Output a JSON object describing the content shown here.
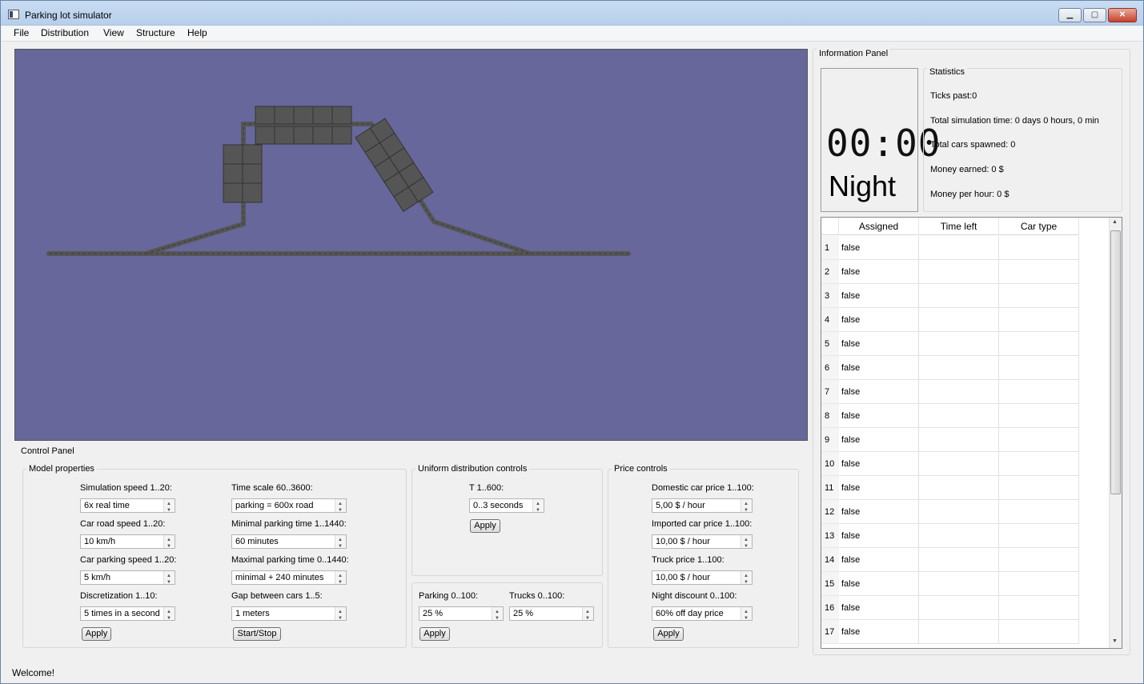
{
  "window": {
    "title": "Parking lot simulator"
  },
  "menu": [
    "File",
    "Distribution",
    "View",
    "Structure",
    "Help"
  ],
  "control_panel": {
    "title": "Control Panel",
    "model": {
      "title": "Model properties",
      "sim_speed_label": "Simulation speed 1..20:",
      "sim_speed_value": "6x real time",
      "road_speed_label": "Car road speed 1..20:",
      "road_speed_value": "10 km/h",
      "parking_speed_label": "Car parking speed 1..20:",
      "parking_speed_value": "5 km/h",
      "discretization_label": "Discretization 1..10:",
      "discretization_value": "5 times in a second",
      "time_scale_label": "Time scale 60..3600:",
      "time_scale_value": "parking = 600x road",
      "min_parking_label": "Minimal parking time 1..1440:",
      "min_parking_value": "60 minutes",
      "max_parking_label": "Maximal parking time 0..1440:",
      "max_parking_value": "minimal + 240 minutes",
      "gap_label": "Gap between cars 1..5:",
      "gap_value": "1 meters",
      "apply_label": "Apply",
      "start_stop_label": "Start/Stop"
    },
    "uniform": {
      "title": "Uniform distribution controls",
      "t_label": "T 1..600:",
      "t_value": "0..3 seconds",
      "apply_label": "Apply"
    },
    "ratios": {
      "parking_label": "Parking 0..100:",
      "parking_value": "25 %",
      "trucks_label": "Trucks 0..100:",
      "trucks_value": "25 %",
      "apply_label": "Apply"
    },
    "price": {
      "title": "Price controls",
      "domestic_label": "Domestic car price 1..100:",
      "domestic_value": "5,00 $ / hour",
      "imported_label": "Imported car price 1..100:",
      "imported_value": "10,00 $ / hour",
      "truck_label": "Truck price 1..100:",
      "truck_value": "10,00 $ / hour",
      "night_label": "Night discount 0..100:",
      "night_value": "60% off day price",
      "apply_label": "Apply"
    }
  },
  "info_panel": {
    "title": "Information Panel",
    "clock": "00:00",
    "period": "Night",
    "statistics": {
      "title": "Statistics",
      "ticks": "Ticks past:0",
      "total_time": "Total simulation time: 0 days 0 hours, 0 min",
      "cars_spawned": "Total cars spawned: 0",
      "money": "Money earned: 0 $",
      "money_per_hour": "Money per hour: 0 $"
    },
    "table": {
      "headers": [
        "Assigned",
        "Time left",
        "Car type"
      ],
      "rows": [
        [
          "1",
          "false"
        ],
        [
          "2",
          "false"
        ],
        [
          "3",
          "false"
        ],
        [
          "4",
          "false"
        ],
        [
          "5",
          "false"
        ],
        [
          "6",
          "false"
        ],
        [
          "7",
          "false"
        ],
        [
          "8",
          "false"
        ],
        [
          "9",
          "false"
        ],
        [
          "10",
          "false"
        ],
        [
          "11",
          "false"
        ],
        [
          "12",
          "false"
        ],
        [
          "13",
          "false"
        ],
        [
          "14",
          "false"
        ],
        [
          "15",
          "false"
        ],
        [
          "16",
          "false"
        ],
        [
          "17",
          "false"
        ]
      ]
    }
  },
  "status": "Welcome!",
  "colors": {
    "canvas": "#67679b",
    "slot": "#555555",
    "road": "#555555"
  }
}
